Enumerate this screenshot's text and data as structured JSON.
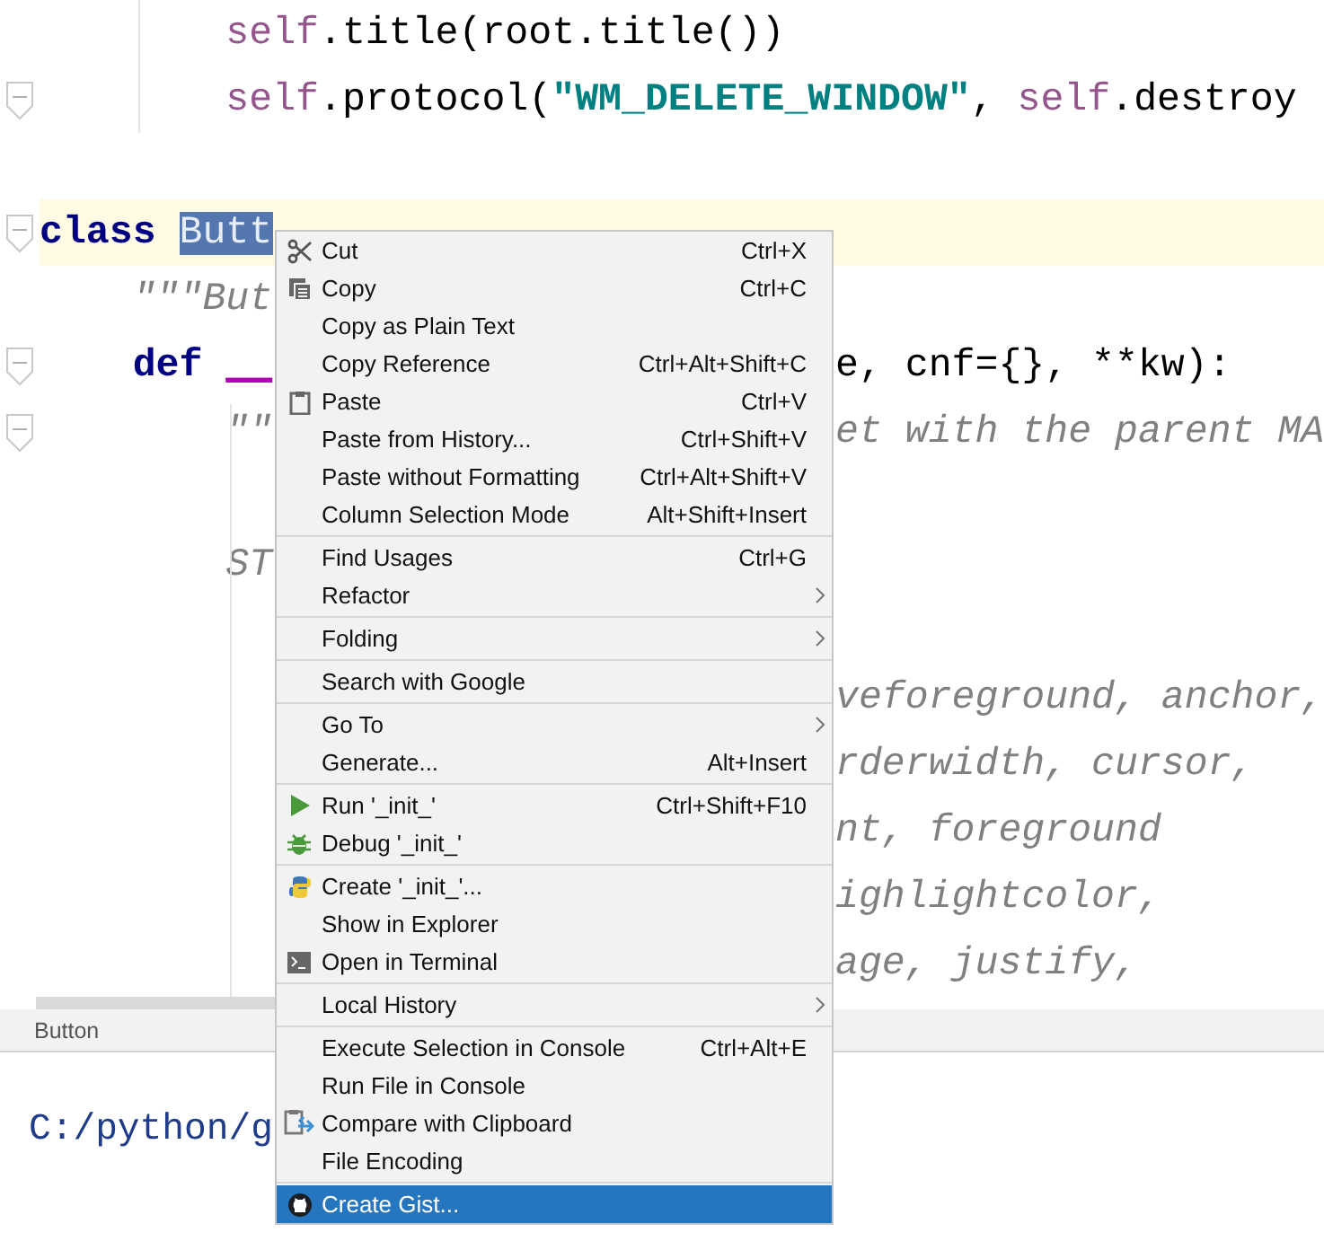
{
  "editor": {
    "lines": [
      {
        "fold_marker": false,
        "current": false,
        "left": [
          {
            "kind": "self",
            "text": "        self"
          },
          {
            "kind": "plain",
            "text": ".title(root.title())"
          }
        ]
      },
      {
        "fold_marker": true,
        "current": false,
        "left": [
          {
            "kind": "self",
            "text": "        self"
          },
          {
            "kind": "plain",
            "text": ".protocol("
          },
          {
            "kind": "string",
            "text": "\"WM_DELETE_WINDOW\""
          },
          {
            "kind": "plain",
            "text": ", "
          },
          {
            "kind": "self",
            "text": "self"
          },
          {
            "kind": "plain",
            "text": ".destroy"
          }
        ]
      },
      {
        "fold_marker": false,
        "current": false
      },
      {
        "fold_marker": true,
        "current": true,
        "left": [
          {
            "kind": "keyword",
            "text": "class "
          },
          {
            "kind": "selected",
            "text": "Butt"
          }
        ]
      },
      {
        "fold_marker": false,
        "current": false,
        "left": [
          {
            "kind": "doc",
            "text": "    \"\"\"But"
          }
        ]
      },
      {
        "fold_marker": true,
        "current": false,
        "left": [
          {
            "kind": "keyword",
            "text": "    def "
          },
          {
            "kind": "magic",
            "text": "__"
          }
        ],
        "right": [
          {
            "kind": "plain",
            "text": "e, cnf={}, **kw):"
          }
        ]
      },
      {
        "fold_marker": true,
        "current": false,
        "left": [
          {
            "kind": "doc",
            "text": "        \"\""
          }
        ],
        "right": [
          {
            "kind": "doc",
            "text": "et with the parent MA"
          }
        ]
      },
      {
        "fold_marker": false,
        "current": false
      },
      {
        "fold_marker": false,
        "current": false,
        "left": [
          {
            "kind": "doc",
            "text": "        ST"
          }
        ]
      },
      {
        "fold_marker": false,
        "current": false
      },
      {
        "fold_marker": false,
        "current": false,
        "right": [
          {
            "kind": "doc",
            "text": "veforeground, anchor,"
          }
        ]
      },
      {
        "fold_marker": false,
        "current": false,
        "right": [
          {
            "kind": "doc",
            "text": "rderwidth, cursor,"
          }
        ]
      },
      {
        "fold_marker": false,
        "current": false,
        "right": [
          {
            "kind": "doc",
            "text": "nt, foreground"
          }
        ]
      },
      {
        "fold_marker": false,
        "current": false,
        "right": [
          {
            "kind": "doc",
            "text": "ighlightcolor,"
          }
        ]
      },
      {
        "fold_marker": false,
        "current": false,
        "right": [
          {
            "kind": "doc",
            "text": "age, justify,"
          }
        ]
      }
    ]
  },
  "breadcrumb": "Button",
  "console": {
    "line": "C:/python/g"
  },
  "context_menu": {
    "groups": [
      [
        {
          "label": "Cut",
          "shortcut": "Ctrl+X",
          "submenu": false,
          "selected": false
        },
        {
          "label": "Copy",
          "shortcut": "Ctrl+C",
          "submenu": false,
          "selected": false
        },
        {
          "label": "Copy as Plain Text",
          "submenu": false,
          "selected": false
        },
        {
          "label": "Copy Reference",
          "shortcut": "Ctrl+Alt+Shift+C",
          "submenu": false,
          "selected": false
        },
        {
          "label": "Paste",
          "shortcut": "Ctrl+V",
          "submenu": false,
          "selected": false
        },
        {
          "label": "Paste from History...",
          "shortcut": "Ctrl+Shift+V",
          "submenu": false,
          "selected": false
        },
        {
          "label": "Paste without Formatting",
          "shortcut": "Ctrl+Alt+Shift+V",
          "submenu": false,
          "selected": false
        },
        {
          "label": "Column Selection Mode",
          "shortcut": "Alt+Shift+Insert",
          "submenu": false,
          "selected": false
        }
      ],
      [
        {
          "label": "Find Usages",
          "shortcut": "Ctrl+G",
          "submenu": false,
          "selected": false
        },
        {
          "label": "Refactor",
          "submenu": true,
          "selected": false
        }
      ],
      [
        {
          "label": "Folding",
          "submenu": true,
          "selected": false
        }
      ],
      [
        {
          "label": "Search with Google",
          "submenu": false,
          "selected": false
        }
      ],
      [
        {
          "label": "Go To",
          "submenu": true,
          "selected": false
        },
        {
          "label": "Generate...",
          "shortcut": "Alt+Insert",
          "submenu": false,
          "selected": false
        }
      ],
      [
        {
          "label": "Run '_init_'",
          "shortcut": "Ctrl+Shift+F10",
          "submenu": false,
          "selected": false
        },
        {
          "label": "Debug '_init_'",
          "submenu": false,
          "selected": false
        }
      ],
      [
        {
          "label": "Create '_init_'...",
          "submenu": false,
          "selected": false
        },
        {
          "label": "Show in Explorer",
          "submenu": false,
          "selected": false
        },
        {
          "label": "Open in Terminal",
          "submenu": false,
          "selected": false
        }
      ],
      [
        {
          "label": "Local History",
          "submenu": true,
          "selected": false
        }
      ],
      [
        {
          "label": "Execute Selection in Console",
          "shortcut": "Ctrl+Alt+E",
          "submenu": false,
          "selected": false
        },
        {
          "label": "Run File in Console",
          "submenu": false,
          "selected": false
        },
        {
          "label": "Compare with Clipboard",
          "submenu": false,
          "selected": false
        },
        {
          "label": "File Encoding",
          "submenu": false,
          "selected": false
        }
      ],
      [
        {
          "label": "Create Gist...",
          "submenu": false,
          "selected": true
        }
      ]
    ]
  }
}
